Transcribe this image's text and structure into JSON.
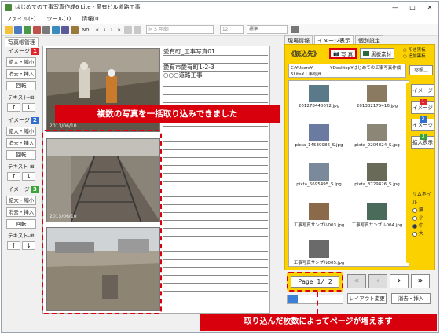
{
  "window": {
    "title": "はじめての工事写真作成6 Lite - 愛有ビル道路工事",
    "controls": [
      "—",
      "□",
      "✕"
    ]
  },
  "menu": [
    "ファイル(F)",
    "ツール(T)",
    "情報(I)"
  ],
  "toolbar": {
    "font": "ＭＳ 明朝",
    "size": "12",
    "style": "標準",
    "label_no": "No."
  },
  "left": {
    "tab": "写真帳管理",
    "groups": [
      {
        "label": "イメージ",
        "num": "1",
        "color": "#e0242b",
        "buttons": [
          "拡大・縮小",
          "消去・挿入",
          "回転"
        ],
        "text": "テキスト-"
      },
      {
        "label": "イメージ",
        "num": "2",
        "color": "#2f6fd0",
        "buttons": [
          "拡大・縮小",
          "消去・挿入",
          "回転"
        ],
        "text": "テキスト-"
      },
      {
        "label": "イメージ",
        "num": "3",
        "color": "#3aa33a",
        "buttons": [
          "拡大・縮小",
          "消去・挿入",
          "回転"
        ],
        "text": "テキスト-"
      }
    ]
  },
  "page": {
    "dates": [
      "2013/06/10",
      "2013/06/10"
    ],
    "text_lines": [
      "愛有町_工事写真01",
      "",
      "愛有市愛有町1-2-3",
      "○○○道路工事"
    ]
  },
  "callouts": {
    "top": "複数の写真を一括取り込みできました",
    "bottom": "取り込んだ枚数によってページが増えます"
  },
  "right": {
    "tabs": [
      "現場情報",
      "イメージ表示",
      "個別設定"
    ],
    "read_title": "《読込先》",
    "source_photo": "写 真",
    "source_blackboard": "黒板素材",
    "radios": [
      "叩き黒板",
      "追加黒板"
    ],
    "path": "C:¥Users¥　　　　¥Desktop¥はじめての工事写真作成5Lite¥工事写真",
    "ref_button": "参照...",
    "thumbs": [
      {
        "name": "201278440672.jpg",
        "color": "#5a7a8a"
      },
      {
        "name": "201382175416.jpg",
        "color": "#8a7a62"
      },
      {
        "name": "pixta_14539986_S.jpg",
        "color": "#6a7aa0"
      },
      {
        "name": "pixta_2204824_S.jpg",
        "color": "#8b8675"
      },
      {
        "name": "pixta_6695495_S.jpg",
        "color": "#7a8a9a"
      },
      {
        "name": "pixta_8729426_S.jpg",
        "color": "#6a6a58"
      },
      {
        "name": "工事写真サンプル003.jpg",
        "color": "#8a6a4a"
      },
      {
        "name": "工事写真サンプル004.jpg",
        "color": "#4a6a5a"
      },
      {
        "name": "工事写真サンプル005.jpg",
        "color": "#6a6a6a"
      }
    ],
    "image_buttons": [
      {
        "label": "イメージ",
        "num": "1",
        "color": "#e0242b"
      },
      {
        "label": "イメージ",
        "num": "2",
        "color": "#2f6fd0"
      },
      {
        "label": "イメージ",
        "num": "3",
        "color": "#3aa33a"
      }
    ],
    "zoom_button": "拡大表示",
    "thumb_size_label": "サムネイル",
    "thumb_sizes": [
      "無",
      "小",
      "中",
      "大"
    ],
    "thumb_size_selected": "中"
  },
  "pager": {
    "page_text": "Page 1/ 2",
    "nav": [
      "«",
      "‹",
      "›",
      "»"
    ],
    "layout_button": "レイアウト変更",
    "erase_button": "消去・挿入",
    "slider_level": 0.18
  }
}
